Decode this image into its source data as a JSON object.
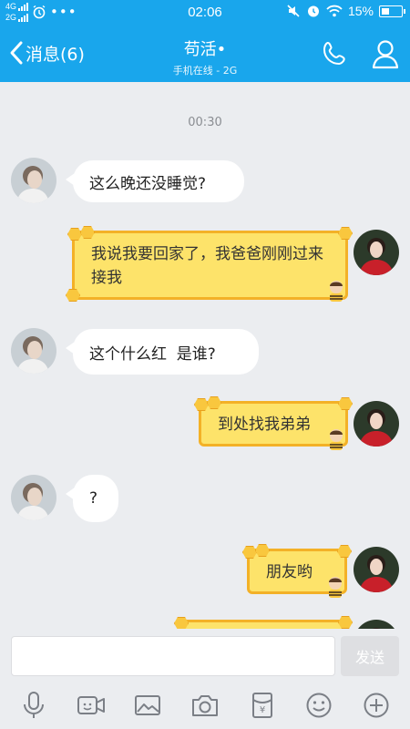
{
  "status_bar": {
    "network_top": "4G",
    "network_bottom": "2G",
    "time": "02:06",
    "battery": "15%"
  },
  "header": {
    "back_label": "消息(6)",
    "contact_name": "苟活•",
    "contact_status": "手机在线 - 2G"
  },
  "chat": {
    "timestamp": "00:30",
    "messages": [
      {
        "side": "in",
        "text": "这么晚还没睡觉?"
      },
      {
        "side": "out",
        "text": "我说我要回家了，我爸爸刚刚过来接我"
      },
      {
        "side": "in",
        "text": "这个什么红  是谁?"
      },
      {
        "side": "out",
        "text": "到处找我弟弟"
      },
      {
        "side": "in",
        "text": "?"
      },
      {
        "side": "out",
        "text": "朋友哟"
      }
    ]
  },
  "input": {
    "placeholder": "",
    "send_label": "发送"
  },
  "toolbar": {
    "items": [
      "microphone-icon",
      "video-icon",
      "image-icon",
      "camera-icon",
      "red-packet-icon",
      "emoji-icon",
      "plus-icon"
    ]
  },
  "colors": {
    "header_bg": "#19a6ec",
    "chat_bg": "#ebedf0",
    "bubble_out": "#fde36a",
    "bubble_out_border": "#f3b127"
  }
}
